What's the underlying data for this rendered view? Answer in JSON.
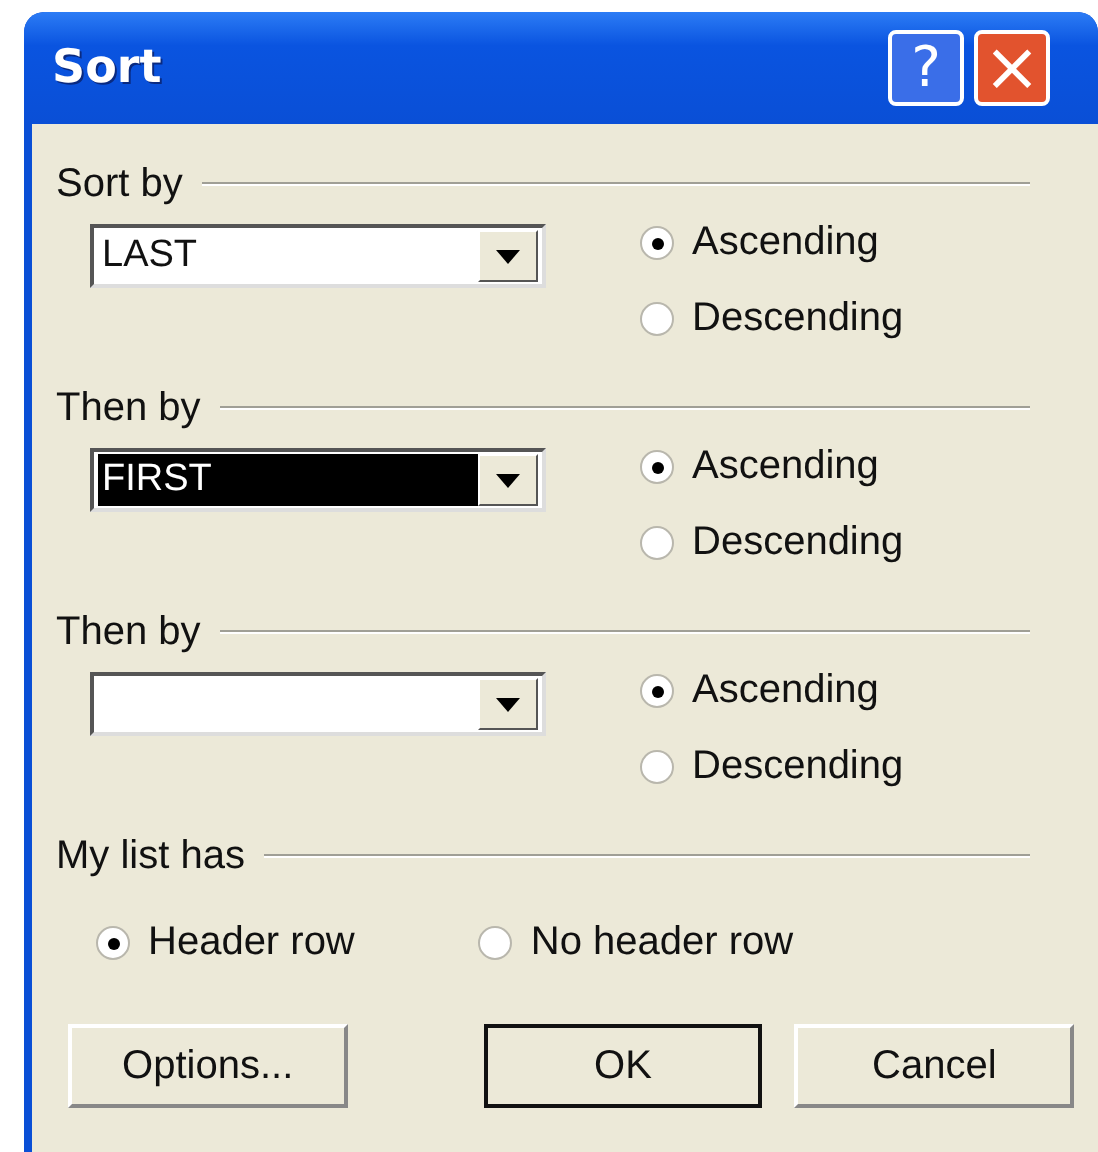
{
  "window": {
    "title": "Sort",
    "buttons": [
      {
        "kind": "help",
        "label": "?"
      },
      {
        "kind": "close",
        "label": "×"
      }
    ]
  },
  "sort_keys": [
    {
      "label": "Sort by",
      "field": {
        "value": "LAST",
        "selected": false
      },
      "orders": [
        {
          "label": "Ascending",
          "selected": true
        },
        {
          "label": "Descending",
          "selected": false
        }
      ]
    },
    {
      "label": "Then by",
      "field": {
        "value": "FIRST",
        "selected": true
      },
      "orders": [
        {
          "label": "Ascending",
          "selected": true
        },
        {
          "label": "Descending",
          "selected": false
        }
      ]
    },
    {
      "label": "Then by",
      "field": {
        "selected": false
      },
      "orders": [
        {
          "label": "Ascending",
          "selected": true
        },
        {
          "label": "Descending",
          "selected": false
        }
      ]
    }
  ],
  "header": {
    "label": "My list has",
    "options": [
      {
        "label": "Header row",
        "selected": true
      },
      {
        "label": "No header row",
        "selected": false
      }
    ]
  },
  "buttons": [
    {
      "label": "Options...",
      "default": false
    },
    {
      "label": "OK",
      "default": true
    },
    {
      "label": "Cancel",
      "default": false
    }
  ]
}
